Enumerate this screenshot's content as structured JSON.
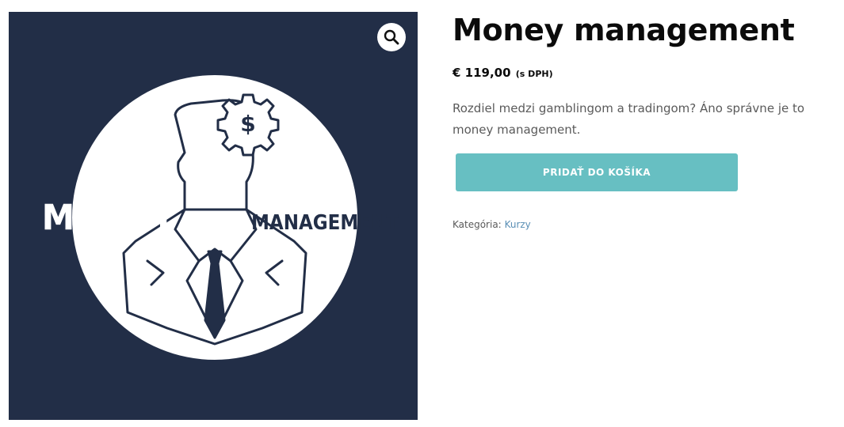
{
  "product": {
    "title": "Money management",
    "price": "€ 119,00",
    "price_suffix": "(s DPH)",
    "short_description": "Rozdiel medzi gamblingom a tradingom? Áno správne je to money management.",
    "add_to_cart_label": "PRIDAŤ DO KOŠÍKA",
    "category_label": "Kategória:",
    "category_value": "Kurzy"
  },
  "image": {
    "text_left": "MONEY",
    "text_right": "MANAGEMENT",
    "gear_symbol": "$",
    "background_color": "#222e47",
    "circle_color": "#ffffff"
  },
  "icons": {
    "zoom": "magnifier-icon"
  },
  "colors": {
    "button": "#67bfc2",
    "link": "#5a8fb5",
    "title": "#0b0b0b",
    "body_text": "#5a5a5a"
  }
}
